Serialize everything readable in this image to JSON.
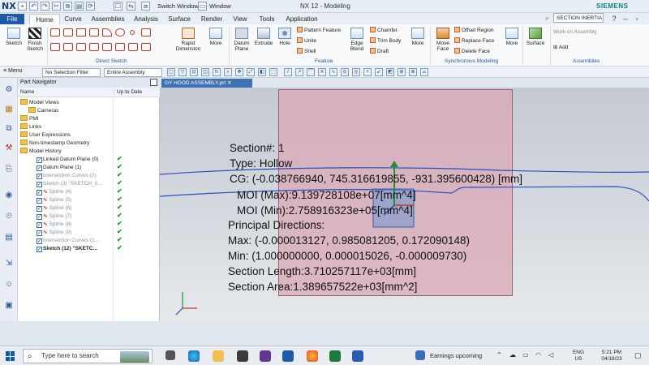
{
  "app": {
    "logo": "NX",
    "title": "NX 12 - Modeling",
    "brand": "SIEMENS",
    "switch_window": "Switch Window",
    "window_menu": "Window"
  },
  "tabs": [
    "File",
    "Home",
    "Curve",
    "Assemblies",
    "Analysis",
    "Surface",
    "Render",
    "View",
    "Tools",
    "Application"
  ],
  "section_inertia": "SECTION INERTIA",
  "ribbon": {
    "sketch": "Sketch",
    "finish_sketch": "Finish Sketch",
    "direct_sketch": "Direct Sketch",
    "rapid_dimension": "Rapid Dimension",
    "more": "More",
    "datum_plane": "Datum Plane",
    "extrude": "Extrude",
    "hole": "Hole",
    "pattern_feature": "Pattern Feature",
    "unite": "Unite",
    "shell": "Shell",
    "edge_blend": "Edge Blend",
    "chamfer": "Chamfer",
    "trim_body": "Trim Body",
    "draft": "Draft",
    "feature": "Feature",
    "move_face": "Move Face",
    "offset_region": "Offset Region",
    "replace_face": "Replace Face",
    "delete_face": "Delete Face",
    "synchronous_modeling": "Synchronous Modeling",
    "surface": "Surface",
    "work_on_assembly": "Work on Assembly",
    "add": "Add",
    "assemblies": "Assemblies"
  },
  "selbar": {
    "menu": "Menu",
    "selection_filter": "No Selection Filter",
    "assembly_scope": "Entire Assembly"
  },
  "navigator": {
    "title": "Part Navigator",
    "col_name": "Name",
    "col_uptodate": "Up to Date",
    "rows": [
      {
        "label": "Model Views",
        "check": false,
        "grey": false,
        "bold": false
      },
      {
        "label": "Cameras",
        "check": false,
        "grey": false,
        "bold": false
      },
      {
        "label": "PMI",
        "check": false,
        "grey": false,
        "bold": false
      },
      {
        "label": "Links",
        "check": false,
        "grey": false,
        "bold": false
      },
      {
        "label": "User Expressions",
        "check": false,
        "grey": false,
        "bold": false
      },
      {
        "label": "Non-timestamp Geometry",
        "check": false,
        "grey": false,
        "bold": false
      },
      {
        "label": "Model History",
        "check": false,
        "grey": false,
        "bold": false
      },
      {
        "label": "Linked Datum Plane (0)",
        "check": true,
        "grey": false,
        "bold": false
      },
      {
        "label": "Datum Plane (1)",
        "check": true,
        "grey": false,
        "bold": false
      },
      {
        "label": "Intersection Curves (2)",
        "check": true,
        "grey": true,
        "bold": false
      },
      {
        "label": "Sketch (3) \"SKETCH_0...",
        "check": true,
        "grey": true,
        "bold": false
      },
      {
        "label": "Spline (4)",
        "check": true,
        "grey": true,
        "bold": false
      },
      {
        "label": "Spline (5)",
        "check": true,
        "grey": true,
        "bold": false
      },
      {
        "label": "Spline (6)",
        "check": true,
        "grey": true,
        "bold": false
      },
      {
        "label": "Spline (7)",
        "check": true,
        "grey": true,
        "bold": false
      },
      {
        "label": "Spline (8)",
        "check": true,
        "grey": true,
        "bold": false
      },
      {
        "label": "Spline (9)",
        "check": true,
        "grey": true,
        "bold": false
      },
      {
        "label": "Intersection Curves (1...",
        "check": true,
        "grey": true,
        "bold": false
      },
      {
        "label": "Sketch (12) \"SKETC...",
        "check": true,
        "grey": false,
        "bold": true
      }
    ]
  },
  "graphics": {
    "tab": "GY HOOD ASSEMBLY.prt",
    "lines": [
      "Section#: 1",
      "Type: Hollow",
      "CG: (-0.038766940, 745.316619855, -931.395600428) [mm]",
      "MOI (Max):9.139728108e+07[mm^4]",
      "MOI (Min):2.758916323e+05[mm^4]",
      "Principal Directions:",
      "Max: (-0.000013127, 0.985081205, 0.172090148)",
      "Min: (1.000000000, 0.000015026, -0.000009730)",
      "Section Length:3.710257117e+03[mm]",
      "Section Area:1.389657522e+03[mm^2]"
    ]
  },
  "taskbar": {
    "search": "Type here to search",
    "news": "Earnings upcoming",
    "lang": "ENG",
    "region": "US",
    "time": "5:21 PM",
    "date": "04/18/23"
  },
  "colors": {
    "accent": "#1f5aa6",
    "pink_section": "#daa8b6",
    "curve": "#2a4fbf"
  }
}
